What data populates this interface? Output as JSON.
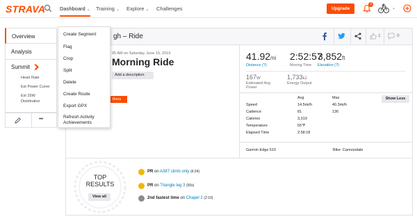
{
  "brand": "STRAVA",
  "nav": {
    "dashboard": "Dashboard",
    "training": "Training",
    "explore": "Explore",
    "challenges": "Challenges",
    "upgrade": "Upgrade",
    "notification_count": "3"
  },
  "sidebar": {
    "items": [
      "Overview",
      "Analysis",
      "Summit"
    ],
    "summit_sub": [
      "Heart Rate",
      "Est Power Curve",
      "Est 25W Distribution"
    ],
    "more": "•••"
  },
  "menu": {
    "items": [
      "Create Segment",
      "Flag",
      "Crop",
      "Split",
      "Delete",
      "Create Route",
      "Export GPX",
      "Refresh Activity Achievements"
    ]
  },
  "activity": {
    "header_title": "gh – Ride",
    "datetime": "05 AM on Saturday, June 15, 2019",
    "name": "Morning Ride",
    "add_description": "Add a description",
    "others_tag": "thers",
    "kudos_count": "1",
    "comment_count": "0"
  },
  "stats": {
    "distance": {
      "value": "41.92",
      "unit": "mi",
      "label": "Distance"
    },
    "moving_time": {
      "value": "2:52:57",
      "label": "Moving Time"
    },
    "elevation": {
      "value": "3,852",
      "unit": "ft",
      "label": "Elevation"
    },
    "power": {
      "value": "167",
      "unit": "W",
      "label": "Estimated Avg Power"
    },
    "energy": {
      "value": "1,733",
      "unit": "kJ",
      "label": "Energy Output"
    }
  },
  "table": {
    "col_avg": "Avg",
    "col_max": "Max",
    "show_less": "Show Less",
    "rows": [
      {
        "label": "Speed",
        "avg": "14.5mi/h",
        "max": "40.3mi/h"
      },
      {
        "label": "Cadence",
        "avg": "81",
        "max": "136"
      },
      {
        "label": "Calories",
        "avg": "3,319",
        "max": ""
      },
      {
        "label": "Temperature",
        "avg": "55℉",
        "max": ""
      },
      {
        "label": "Elapsed Time",
        "avg": "2:58:18",
        "max": ""
      }
    ]
  },
  "gear": {
    "device": "Garmin Edge 510",
    "bike": "Bike: Cannondale"
  },
  "results": {
    "title_line1": "TOP",
    "title_line2": "RESULTS",
    "view_all": "View all",
    "items": [
      {
        "rank": "PR",
        "pre": " on ",
        "segment": "A387 climb only",
        "time": "(6:24)"
      },
      {
        "rank": "PR",
        "pre": " on ",
        "segment": "Triangle leg 3",
        "time": "(50s)"
      },
      {
        "rank": "2nd fastest time",
        "pre": " on ",
        "segment": "Chapel 2",
        "time": "(2:10)"
      }
    ]
  },
  "colors": {
    "brand_orange": "#fc4c02",
    "link_blue": "#007fb6",
    "facebook": "#3b5998",
    "twitter": "#1da1f2",
    "gold_medal": "#f5b400",
    "silver_medal": "#8c8c8c"
  }
}
